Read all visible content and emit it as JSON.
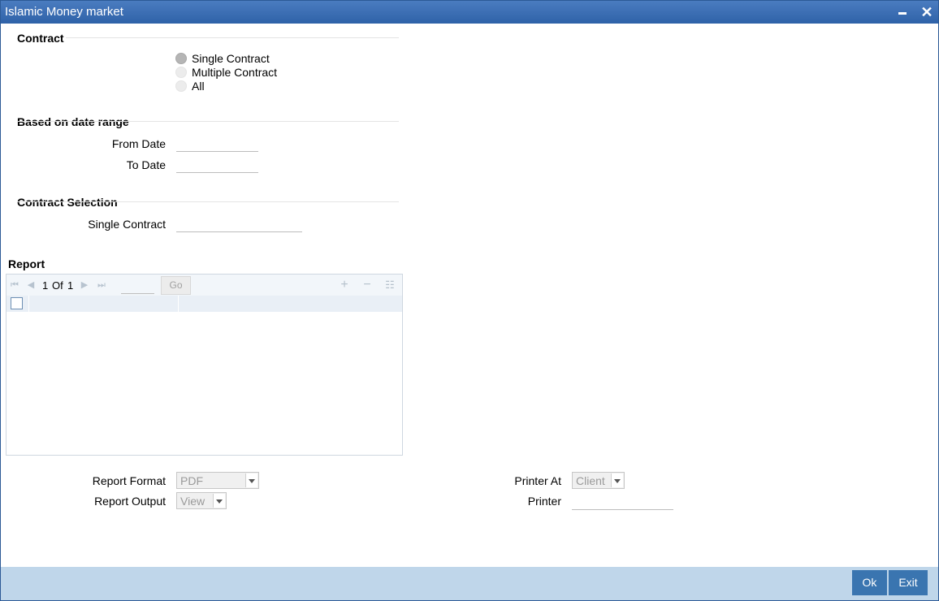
{
  "window": {
    "title": "Islamic Money market",
    "minimize_icon": "minimize-icon",
    "close_icon": "close-icon"
  },
  "contract": {
    "section_title": "Contract",
    "options": [
      {
        "label": "Single Contract",
        "selected": true
      },
      {
        "label": "Multiple Contract",
        "selected": false
      },
      {
        "label": "All",
        "selected": false
      }
    ]
  },
  "date_range": {
    "section_title": "Based on date range",
    "from_label": "From Date",
    "from_value": "",
    "to_label": "To Date",
    "to_value": ""
  },
  "contract_selection": {
    "section_title": "Contract Selection",
    "single_contract_label": "Single Contract",
    "single_contract_value": ""
  },
  "report": {
    "section_title": "Report",
    "page_current": "1",
    "page_of": "Of",
    "page_total": "1",
    "go_label": "Go",
    "page_input": "",
    "icons": [
      "first-page-icon",
      "prev-page-icon",
      "next-page-icon",
      "last-page-icon",
      "add-row-icon",
      "delete-row-icon",
      "list-view-icon"
    ]
  },
  "output": {
    "report_format_label": "Report Format",
    "report_format_value": "PDF",
    "report_output_label": "Report Output",
    "report_output_value": "View",
    "printer_at_label": "Printer At",
    "printer_at_value": "Client",
    "printer_label": "Printer",
    "printer_value": ""
  },
  "footer": {
    "ok_label": "Ok",
    "exit_label": "Exit"
  },
  "colors": {
    "titlebar": "#2f62a8",
    "footer": "#bfd6ea",
    "button": "#3a75b0"
  }
}
